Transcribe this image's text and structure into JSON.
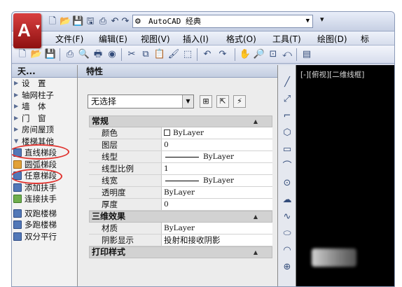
{
  "titlebar": {
    "quick_access_icons": [
      "new-icon",
      "open-icon",
      "save-icon",
      "save-as-icon",
      "print-icon",
      "undo-icon",
      "redo-icon"
    ],
    "workspace": "AutoCAD 经典",
    "app_logo_letter": "A"
  },
  "menubar": {
    "items": [
      "文件(F)",
      "编辑(E)",
      "视图(V)",
      "插入(I)",
      "格式(O)",
      "工具(T)",
      "绘图(D)",
      "标"
    ]
  },
  "toolbar": {
    "icons": [
      "new-icon",
      "open-icon",
      "save-icon",
      "print-icon",
      "preview-icon",
      "publish-icon",
      "3d-publish-icon",
      "cut-icon",
      "copy-icon",
      "paste-icon",
      "match-icon",
      "block-edit-icon",
      "undo-icon",
      "redo-icon",
      "pan-icon",
      "zoom-icon",
      "zoom-window-icon",
      "zoom-prev-icon",
      "properties-icon"
    ]
  },
  "palette": {
    "title": "天...",
    "categories": [
      "设　置",
      "轴网柱子",
      "墙　体",
      "门　窗",
      "房间屋顶",
      "楼梯其他"
    ],
    "tools": [
      "直线梯段",
      "圆弧梯段",
      "任意梯段",
      "添加扶手",
      "连接扶手"
    ],
    "tools2": [
      "双跑楼梯",
      "多跑楼梯",
      "双分平行"
    ]
  },
  "properties": {
    "title": "特性",
    "selection": "无选择",
    "sections": {
      "general": "常规",
      "three_d": "三维效果",
      "print": "打印样式"
    },
    "general_rows": [
      {
        "k": "颜色",
        "v": "ByLayer"
      },
      {
        "k": "图层",
        "v": "0"
      },
      {
        "k": "线型",
        "v": "ByLayer"
      },
      {
        "k": "线型比例",
        "v": "1"
      },
      {
        "k": "线宽",
        "v": "ByLayer"
      },
      {
        "k": "透明度",
        "v": "ByLayer"
      },
      {
        "k": "厚度",
        "v": "0"
      }
    ],
    "three_d_rows": [
      {
        "k": "材质",
        "v": "ByLayer"
      },
      {
        "k": "阴影显示",
        "v": "投射和接收阴影"
      }
    ]
  },
  "drawbar": {
    "icons": [
      "line-icon",
      "construction-line-icon",
      "polyline-icon",
      "polygon-icon",
      "rectangle-icon",
      "arc-icon",
      "circle-icon",
      "revcloud-icon",
      "spline-icon",
      "ellipse-icon",
      "ellipse-arc-icon",
      "insert-block-icon"
    ]
  },
  "canvas": {
    "viewport_label": "[-][俯视][二维线框]",
    "background": "#000000"
  },
  "colors": {
    "highlight_circle": "#e0332f",
    "logo": "#c0282a"
  }
}
